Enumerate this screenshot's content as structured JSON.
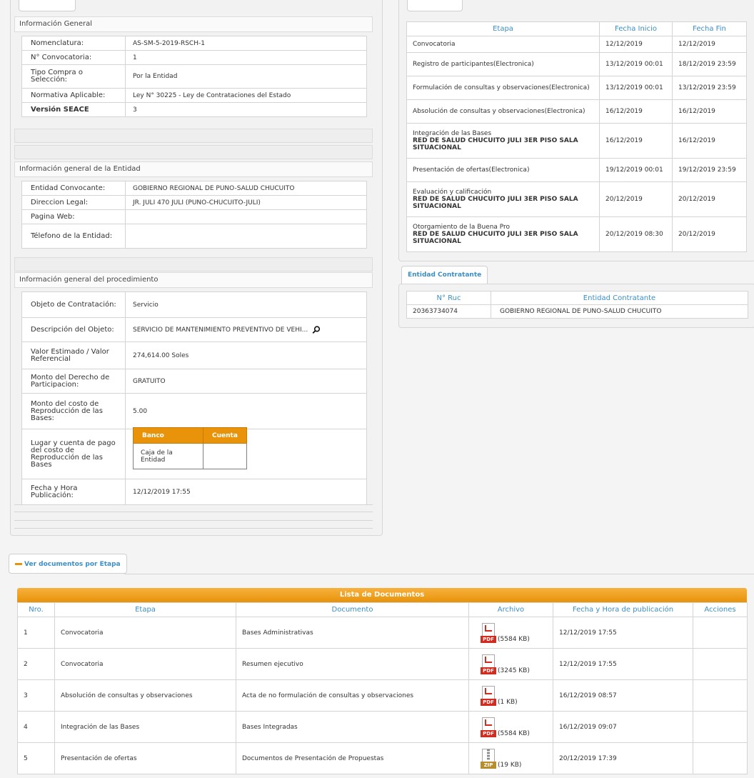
{
  "left": {
    "info_general": {
      "title": "Información General",
      "rows": [
        {
          "k": "Nomenclatura:",
          "v": "AS-SM-5-2019-RSCH-1"
        },
        {
          "k": "N° Convocatoria:",
          "v": "1"
        },
        {
          "k": "Tipo Compra o Selección:",
          "v": "Por la Entidad"
        },
        {
          "k": "Normativa Aplicable:",
          "v": "Ley N° 30225 - Ley de Contrataciones del Estado"
        },
        {
          "k": "Versión SEACE",
          "v": "3"
        }
      ]
    },
    "entidad": {
      "title": "Información general de la Entidad",
      "rows": [
        {
          "k": "Entidad Convocante:",
          "v": "GOBIERNO REGIONAL DE PUNO-SALUD CHUCUITO"
        },
        {
          "k": "Direccion Legal:",
          "v": "JR. JULI 470 JULI (PUNO-CHUCUITO-JULI)"
        },
        {
          "k": "Pagina Web:",
          "v": ""
        },
        {
          "k": "Télefono de la Entidad:",
          "v": ""
        }
      ]
    },
    "procedimiento": {
      "title": "Información general del procedimiento",
      "rows": [
        {
          "k": "Objeto de Contratación:",
          "v": "Servicio"
        },
        {
          "k": "Descripción del Objeto:",
          "v": "SERVICIO DE MANTENIMIENTO PREVENTIVO DE VEHI..."
        },
        {
          "k": "Valor Estimado / Valor Referencial",
          "v": "274,614.00 Soles"
        },
        {
          "k": "Monto del Derecho de Participacion:",
          "v": "GRATUITO"
        },
        {
          "k": "Monto del costo de Reproducción de las Bases:",
          "v": "5.00"
        },
        {
          "k": "Lugar y cuenta de pago del costo de Reproducción de las Bases",
          "v": ""
        },
        {
          "k": "Fecha y Hora Publicación:",
          "v": "12/12/2019 17:55"
        }
      ],
      "bank": {
        "col_banco": "Banco",
        "col_cuenta": "Cuenta",
        "banco": "Caja de la Entidad",
        "cuenta": ""
      }
    }
  },
  "cronograma": {
    "headers": [
      "Etapa",
      "Fecha Inicio",
      "Fecha Fin"
    ],
    "rows": [
      {
        "etapa": "Convocatoria",
        "extra": "",
        "ini": "12/12/2019",
        "fin": "12/12/2019"
      },
      {
        "etapa": "Registro de participantes(Electronica)",
        "extra": "",
        "ini": "13/12/2019 00:01",
        "fin": "18/12/2019 23:59"
      },
      {
        "etapa": "Formulación de consultas y observaciones(Electronica)",
        "extra": "",
        "ini": "13/12/2019 00:01",
        "fin": "13/12/2019 23:59"
      },
      {
        "etapa": "Absolución de consultas y observaciones(Electronica)",
        "extra": "",
        "ini": "16/12/2019",
        "fin": "16/12/2019"
      },
      {
        "etapa": "Integración de las Bases",
        "extra": "RED DE SALUD CHUCUITO JULI 3ER PISO SALA SITUACIONAL",
        "ini": "16/12/2019",
        "fin": "16/12/2019"
      },
      {
        "etapa": "Presentación de ofertas(Electronica)",
        "extra": "",
        "ini": "19/12/2019 00:01",
        "fin": "19/12/2019 23:59"
      },
      {
        "etapa": "Evaluación y calificación",
        "extra": "RED DE SALUD CHUCUITO JULI 3ER PISO SALA SITUACIONAL",
        "ini": "20/12/2019",
        "fin": "20/12/2019"
      },
      {
        "etapa": "Otorgamiento de la Buena Pro",
        "extra": "RED DE SALUD CHUCUITO JULI 3ER PISO SALA SITUACIONAL",
        "ini": "20/12/2019 08:30",
        "fin": "20/12/2019"
      }
    ]
  },
  "entidad_contratante": {
    "tab": "Entidad Contratante",
    "headers": [
      "N° Ruc",
      "Entidad Contratante"
    ],
    "rows": [
      {
        "ruc": "20363734074",
        "entidad": "GOBIERNO REGIONAL DE PUNO-SALUD CHUCUITO"
      }
    ]
  },
  "documentos": {
    "tab": "Ver documentos por Etapa",
    "title": "Lista de Documentos",
    "headers": [
      "Nro.",
      "Etapa",
      "Documento",
      "Archivo",
      "Fecha y Hora de publicación",
      "Acciones"
    ],
    "rows": [
      {
        "nro": "1",
        "etapa": "Convocatoria",
        "doc": "Bases Administrativas",
        "type": "PDF",
        "size": "(5584 KB)",
        "fecha": "12/12/2019 17:55"
      },
      {
        "nro": "2",
        "etapa": "Convocatoria",
        "doc": "Resumen ejecutivo",
        "type": "PDF",
        "size": "(3245 KB)",
        "fecha": "12/12/2019 17:55"
      },
      {
        "nro": "3",
        "etapa": "Absolución de consultas y observaciones",
        "doc": "Acta de no formulación de consultas y observaciones",
        "type": "PDF",
        "size": "(1 KB)",
        "fecha": "16/12/2019 08:57"
      },
      {
        "nro": "4",
        "etapa": "Integración de las Bases",
        "doc": "Bases Integradas",
        "type": "PDF",
        "size": "(5584 KB)",
        "fecha": "16/12/2019 09:07"
      },
      {
        "nro": "5",
        "etapa": "Presentación de ofertas",
        "doc": "Documentos de Presentación de Propuestas",
        "type": "ZIP",
        "size": "(19 KB)",
        "fecha": "20/12/2019 17:39"
      }
    ]
  },
  "colors": {
    "accent_blue": "#3b8fc4",
    "accent_orange": "#e8930a"
  },
  "icons": {
    "search": "search-icon",
    "pdf": "pdf-file-icon",
    "zip": "zip-file-icon"
  }
}
